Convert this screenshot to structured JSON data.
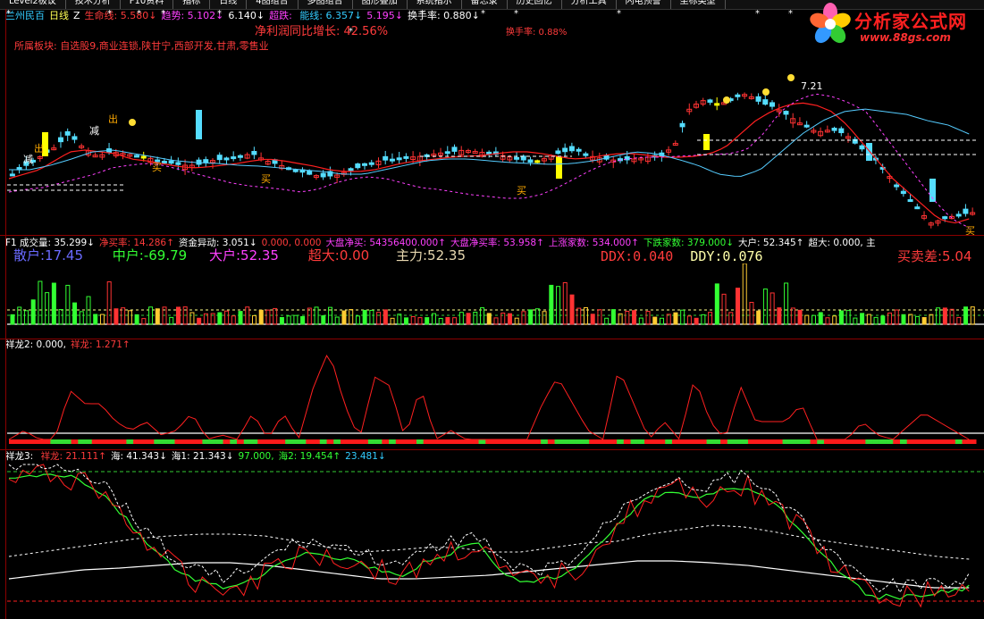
{
  "menu": [
    "Level2极议",
    "技术分析",
    "F10资料",
    "指标",
    "日线",
    "4图组合",
    "多图组合",
    "图形叠加",
    "系统指示",
    "备忘录",
    "历史回忆",
    "分析工具",
    "闪电预警",
    "坐标类型"
  ],
  "header": {
    "stock": "兰州民百",
    "period": "日线",
    "z": "Z",
    "items": [
      {
        "label": "生命线",
        "value": "5.580",
        "arrow": "↓"
      },
      {
        "label": "趋势",
        "value": "5.102",
        "arrow": "↓"
      },
      {
        "label": "",
        "value": "6.140",
        "arrow": "↓"
      },
      {
        "label": "超跌",
        "value": "",
        "arrow": ""
      },
      {
        "label": "能线",
        "value": "6.357",
        "arrow": "↓"
      },
      {
        "label": "",
        "value": "5.195",
        "arrow": "↓"
      },
      {
        "label": "换手率",
        "value": "0.880",
        "arrow": "↓"
      }
    ],
    "profit_growth": "净利润同比增长: 42.56%",
    "turnover2": "换手率: 0.88%",
    "sector": "所属板块: 自选股9,商业连锁,陕甘宁,西部开发,甘肃,零售业"
  },
  "main_chart": {
    "annotations": [
      "减",
      "出",
      "减",
      "出",
      "买",
      "买",
      "买",
      "买"
    ],
    "price_label": "7.21",
    "colors": {
      "up": "#ff3333",
      "down": "#55ddff",
      "yellow": "#ffff00",
      "ma1": "#ff2020",
      "ma2": "#ff40ff",
      "ma3": "#55ccff"
    }
  },
  "volume_panel": {
    "header": [
      {
        "label": "F1 成交量",
        "value": "35.299",
        "arrow": "↓"
      },
      {
        "label": "净买率",
        "value": "14.286",
        "arrow": "↑"
      },
      {
        "label": "资金异动",
        "value": "3.051",
        "arrow": "↓"
      },
      {
        "label": "",
        "value": "0.000, 0.000",
        "arrow": ""
      },
      {
        "label": "大盘净买",
        "value": "54356400.000",
        "arrow": "↑"
      },
      {
        "label": "大盘净买率",
        "value": "53.958",
        "arrow": "↑"
      },
      {
        "label": "上涨家数",
        "value": "534.000",
        "arrow": "↑"
      },
      {
        "label": "下跌家数",
        "value": "379.000",
        "arrow": "↓"
      },
      {
        "label": "大户",
        "value": "52.345",
        "arrow": "↑"
      },
      {
        "label": "超大",
        "value": "0.000, 主",
        "arrow": ""
      }
    ],
    "stats": {
      "sanhu": "散户:17.45",
      "zhonghu": "中户:-69.79",
      "dahu": "大户:52.35",
      "chaoda": "超大:0.00",
      "zhuli": "主力:52.35",
      "ddx": "DDX:0.040",
      "ddy": "DDY:0.076",
      "maimai": "买卖差:5.04"
    }
  },
  "xianglong2": {
    "header": [
      {
        "label": "祥龙2",
        "value": "0.000",
        "arrow": ","
      },
      {
        "label": "祥龙",
        "value": "1.271",
        "arrow": "↑"
      }
    ]
  },
  "xianglong3": {
    "header": [
      {
        "label": "祥龙3",
        "value": "",
        "arrow": ""
      },
      {
        "label": "祥龙",
        "value": "21.111",
        "arrow": "↑"
      },
      {
        "label": "海",
        "value": "41.343",
        "arrow": "↓"
      },
      {
        "label": "海1",
        "value": "21.343",
        "arrow": "↓"
      },
      {
        "label": "",
        "value": "97.000",
        "arrow": ","
      },
      {
        "label": "海2",
        "value": "19.454",
        "arrow": "↑"
      },
      {
        "label": "",
        "value": "23.481",
        "arrow": "↓"
      }
    ]
  },
  "logo": {
    "title": "分析家公式网",
    "url": "www.88gs.com"
  }
}
